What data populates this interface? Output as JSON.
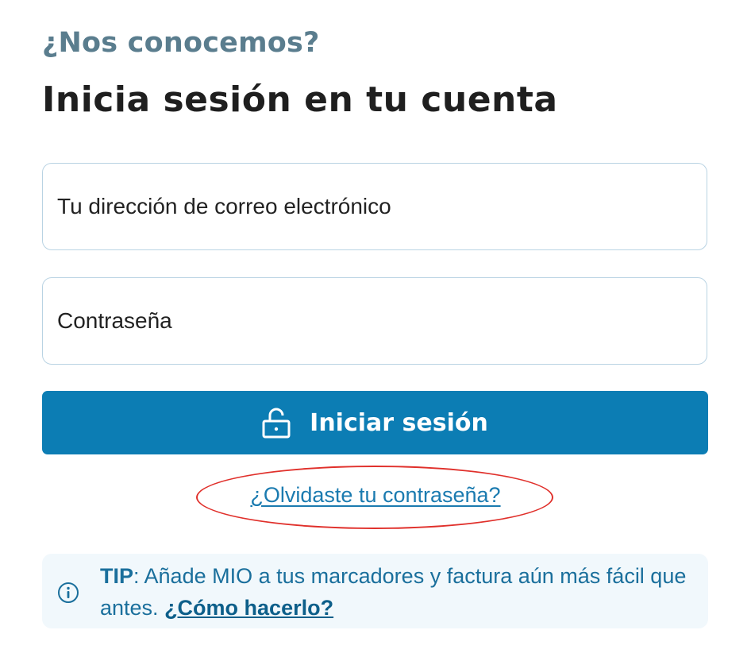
{
  "header": {
    "eyebrow": "¿Nos conocemos?",
    "title": "Inicia sesión en tu cuenta"
  },
  "form": {
    "email_placeholder": "Tu dirección de correo electrónico",
    "email_value": "",
    "password_placeholder": "Contraseña",
    "password_value": "",
    "submit_label": "Iniciar sesión",
    "submit_icon": "unlock-icon",
    "forgot_link": "¿Olvidaste tu contraseña?"
  },
  "tip": {
    "icon": "info-icon",
    "label": "TIP",
    "text": ": Añade MIO a tus marcadores y factura aún más fácil que antes. ",
    "link": "¿Cómo hacerlo?"
  },
  "colors": {
    "primary": "#0c7db4",
    "link": "#1b7bb0",
    "highlight": "#e0302b",
    "tip_bg": "#f1f8fc"
  }
}
